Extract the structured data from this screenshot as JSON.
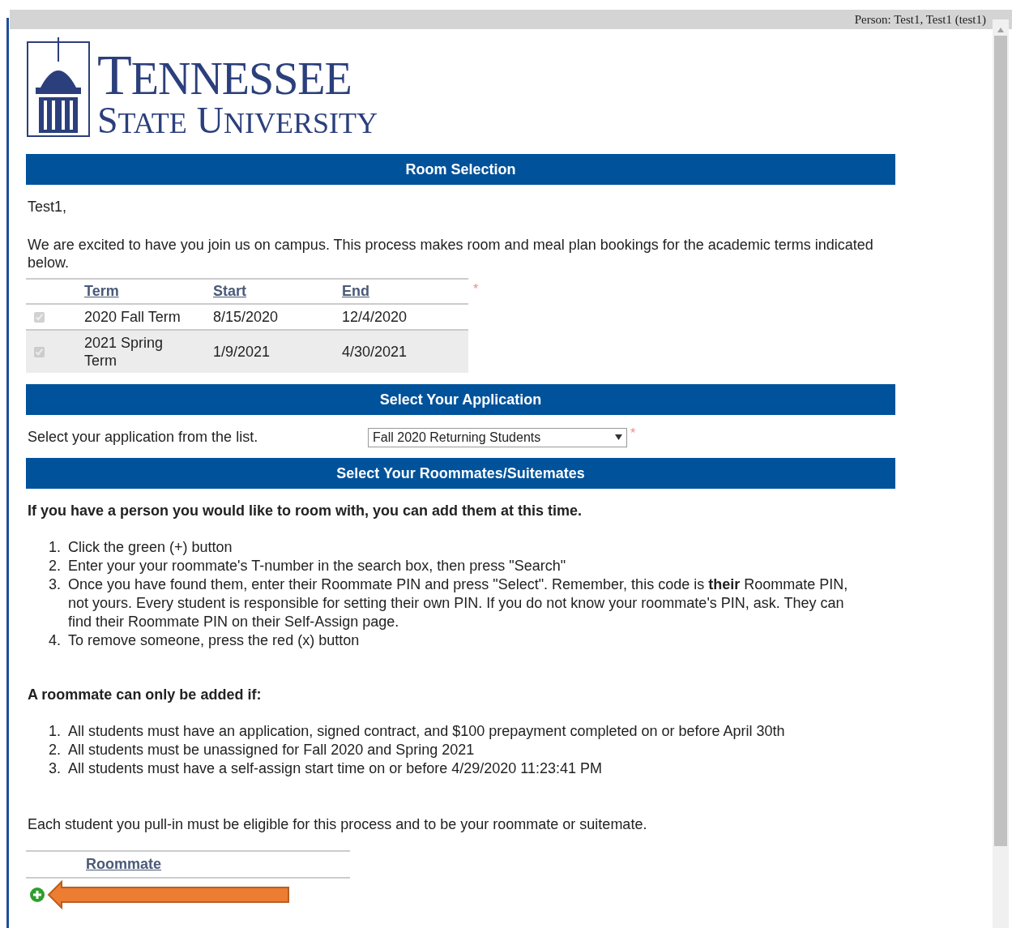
{
  "header": {
    "person": "Person: Test1, Test1 (test1)"
  },
  "logo": {
    "line_1": "TENNESSEE",
    "line_2": "STATE UNIVERSITY"
  },
  "sections": [
    {
      "title": "Room Selection"
    },
    {
      "title": "Select Your Application"
    },
    {
      "title": "Select Your Roommates/Suitemates"
    }
  ],
  "greeting": "Test1,",
  "intro": "We are excited to have you join us on campus. This process makes room and meal plan bookings for the academic terms indicated below.",
  "terms_table": {
    "columns": [
      "Term",
      "Start",
      "End"
    ],
    "required_mark": "*",
    "rows": [
      {
        "checked": true,
        "term": "2020 Fall Term",
        "start": "8/15/2020",
        "end": "12/4/2020"
      },
      {
        "checked": true,
        "term": "2021 Spring Term",
        "start": "1/9/2021",
        "end": "4/30/2021"
      }
    ]
  },
  "application": {
    "label": "Select your application from the list.",
    "value": "Fall 2020 Returning Students",
    "required_mark": "*"
  },
  "roommate_heading": "If you have a person you would like to room with, you can add them at this time.",
  "steps": [
    {
      "number": "1.",
      "text": "Click the green (+) button"
    },
    {
      "number": "2.",
      "text": "Enter your your roommate's T-number in the search box, then press \"Search\""
    },
    {
      "number": "3.",
      "text": "Once you have found them, enter their Roommate PIN and press \"Select\". Remember, this code is **their** Roommate PIN, not yours. Every student is responsible for setting their own PIN. If you do not know your roommate's PIN, ask. They can find their Roommate PIN on their Self-Assign page."
    },
    {
      "number": "4.",
      "text": "To remove someone, press the red (x) button"
    }
  ],
  "conditions_heading": "A roommate can only be added if:",
  "conditions": [
    {
      "number": "1.",
      "text": "All students must have an application, signed contract, and $100 prepayment completed on or before April 30th"
    },
    {
      "number": "2.",
      "text": "All students must be unassigned for Fall 2020 and Spring 2021"
    },
    {
      "number": "3.",
      "text": "All students must have a self-assign start time on or before 4/29/2020 11:23:41 PM"
    }
  ],
  "eligibility_note": "Each student you pull-in must be eligible for this process and to be your roommate or suitemate.",
  "roommate_table": {
    "columns": [
      "Roommate"
    ]
  }
}
